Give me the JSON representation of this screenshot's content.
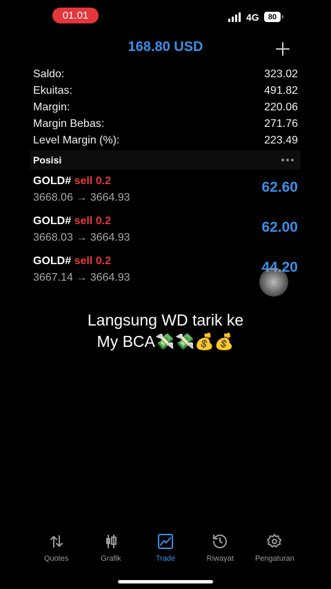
{
  "status_bar": {
    "time": "01.01",
    "network": "4G",
    "battery": "80"
  },
  "header": {
    "title": "168.80 USD",
    "add_icon": "plus-icon"
  },
  "summary": [
    {
      "label": "Saldo:",
      "value": "323.02"
    },
    {
      "label": "Ekuitas:",
      "value": "491.82"
    },
    {
      "label": "Margin:",
      "value": "220.06"
    },
    {
      "label": "Margin Bebas:",
      "value": "271.76"
    },
    {
      "label": "Level Margin (%):",
      "value": "223.49"
    }
  ],
  "positions_header": {
    "title": "Posisi",
    "more_icon": "more-dots-icon"
  },
  "positions": [
    {
      "symbol": "GOLD#",
      "side": "sell 0.2",
      "prices": "3668.06 → 3664.93",
      "profit": "62.60"
    },
    {
      "symbol": "GOLD#",
      "side": "sell 0.2",
      "prices": "3668.03 → 3664.93",
      "profit": "62.00"
    },
    {
      "symbol": "GOLD#",
      "side": "sell 0.2",
      "prices": "3667.14 → 3664.93",
      "profit": "44.20"
    }
  ],
  "caption": {
    "line1": "Langsung WD tarik ke",
    "line2": "My BCA💸💸💰💰"
  },
  "tabs": [
    {
      "label": "Quotes",
      "icon": "quotes-arrows-icon",
      "active": false
    },
    {
      "label": "Grafik",
      "icon": "candlestick-icon",
      "active": false
    },
    {
      "label": "Trade",
      "icon": "trade-chart-icon",
      "active": true
    },
    {
      "label": "Riwayat",
      "icon": "history-clock-icon",
      "active": false
    },
    {
      "label": "Pengaturan",
      "icon": "gear-icon",
      "active": false
    }
  ],
  "colors": {
    "accent": "#3b8fe6",
    "sell": "#e5373b",
    "background": "#000000"
  }
}
